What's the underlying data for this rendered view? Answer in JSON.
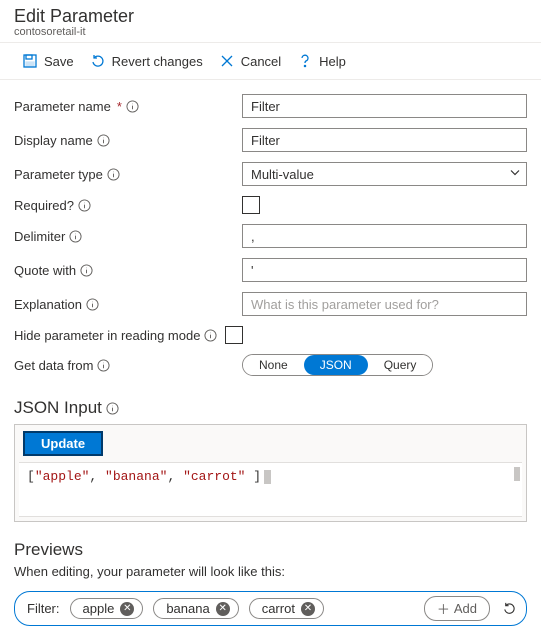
{
  "header": {
    "title": "Edit Parameter",
    "subtitle": "contosoretail-it"
  },
  "toolbar": {
    "save": "Save",
    "revert": "Revert changes",
    "cancel": "Cancel",
    "help": "Help"
  },
  "form": {
    "parameter_name": {
      "label": "Parameter name",
      "value": "Filter"
    },
    "display_name": {
      "label": "Display name",
      "value": "Filter"
    },
    "parameter_type": {
      "label": "Parameter type",
      "value": "Multi-value"
    },
    "required": {
      "label": "Required?"
    },
    "delimiter": {
      "label": "Delimiter",
      "value": ","
    },
    "quote_with": {
      "label": "Quote with",
      "value": "'"
    },
    "explanation": {
      "label": "Explanation",
      "placeholder": "What is this parameter used for?"
    },
    "hide_reading": {
      "label": "Hide parameter in reading mode"
    },
    "get_data": {
      "label": "Get data from",
      "options": [
        "None",
        "JSON",
        "Query"
      ],
      "selected": "JSON"
    }
  },
  "json_input": {
    "title": "JSON Input",
    "update_btn": "Update",
    "code_tokens": [
      "[",
      "\"apple\"",
      ", ",
      "\"banana\"",
      ", ",
      "\"carrot\"",
      " ]"
    ]
  },
  "previews": {
    "title": "Previews",
    "subtitle": "When editing, your parameter will look like this:",
    "filter_label": "Filter:",
    "chips": [
      "apple",
      "banana",
      "carrot"
    ],
    "add_label": "Add"
  }
}
